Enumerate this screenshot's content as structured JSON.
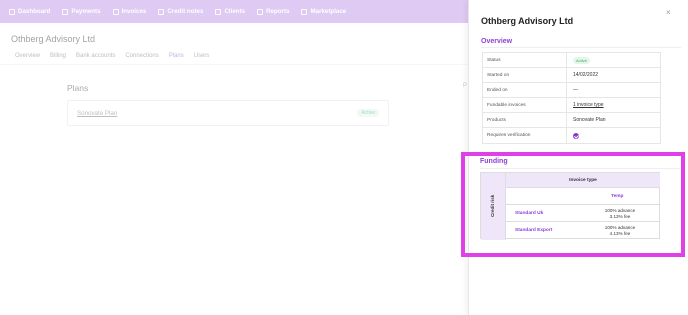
{
  "nav": {
    "items": [
      {
        "label": "Dashboard",
        "icon": "dashboard-icon"
      },
      {
        "label": "Payments",
        "icon": "payments-icon"
      },
      {
        "label": "Invoices",
        "icon": "invoices-icon"
      },
      {
        "label": "Credit notes",
        "icon": "credit-notes-icon"
      },
      {
        "label": "Clients",
        "icon": "clients-icon"
      },
      {
        "label": "Reports",
        "icon": "reports-icon"
      },
      {
        "label": "Marketplace",
        "icon": "marketplace-icon"
      }
    ]
  },
  "page": {
    "company": "Othberg Advisory Ltd",
    "tabs": [
      "Overview",
      "Billing",
      "Bank accounts",
      "Connections",
      "Plans",
      "Users"
    ],
    "active_tab": "Plans",
    "plans_title": "Plans",
    "plan": {
      "name": "Sonovate Plan",
      "status": "Active"
    },
    "side_stub": "P"
  },
  "panel": {
    "title": "Othberg Advisory Ltd",
    "close_icon": "close-icon",
    "overview": {
      "heading": "Overview",
      "rows": [
        {
          "label": "Status",
          "value": "Active"
        },
        {
          "label": "Started on",
          "value": "14/02/2022"
        },
        {
          "label": "Ended on",
          "value": "—"
        },
        {
          "label": "Fundable invoices",
          "value": "1 invoice type"
        },
        {
          "label": "Products",
          "value": "Sonovate Plan"
        },
        {
          "label": "Requires verification",
          "value": ""
        }
      ]
    },
    "funding": {
      "heading": "Funding",
      "row_axis": "Credit risk",
      "col_axis": "Invoice type",
      "col_header": "Temp",
      "rows": [
        {
          "name": "Standard Uk",
          "line1": "100% advance",
          "line2": "3.13% fee"
        },
        {
          "name": "Standard Export",
          "line1": "100% advance",
          "line2": "4.13% fee"
        }
      ]
    }
  },
  "colors": {
    "nav_bg": "#c49ee8",
    "accent": "#8e3fd6",
    "highlight": "#e040e8",
    "active_green": "#3fae6a"
  }
}
